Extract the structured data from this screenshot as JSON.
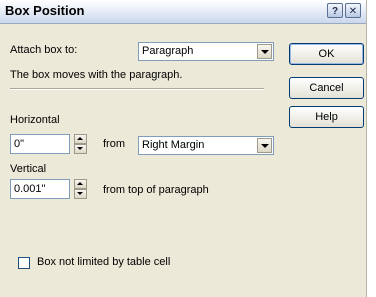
{
  "window": {
    "title": "Box Position",
    "help_glyph": "?",
    "close_glyph": "✕"
  },
  "attach": {
    "label": "Attach box to:",
    "value": "Paragraph",
    "description": "The box moves with the paragraph."
  },
  "horizontal": {
    "label": "Horizontal",
    "value": "0\"",
    "from_label": "from",
    "from_value": "Right Margin"
  },
  "vertical": {
    "label": "Vertical",
    "value": "0.001\"",
    "suffix": "from top of paragraph"
  },
  "table_cell": {
    "label": "Box not limited by table cell",
    "checked": false
  },
  "buttons": {
    "ok": "OK",
    "cancel": "Cancel",
    "help": "Help"
  }
}
